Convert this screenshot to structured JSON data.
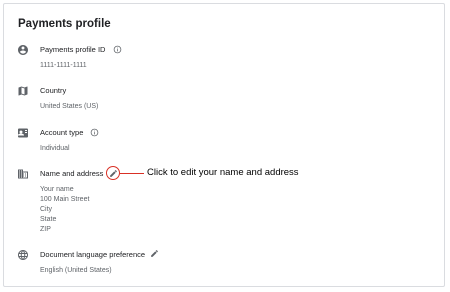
{
  "card": {
    "title": "Payments profile"
  },
  "profile_id": {
    "label": "Payments profile ID",
    "value": "1111-1111-1111",
    "icon": "account-circle-icon"
  },
  "country": {
    "label": "Country",
    "value": "United States (US)",
    "icon": "map-icon"
  },
  "account_type": {
    "label": "Account type",
    "value": "Individual",
    "icon": "id-card-icon"
  },
  "name_address": {
    "label": "Name and address",
    "lines": [
      "Your name",
      "100 Main Street",
      "City",
      "State",
      "ZIP"
    ],
    "icon": "building-icon"
  },
  "callout": {
    "text": "Click to edit your name and address",
    "color": "#d93025"
  },
  "document_language": {
    "label": "Document language preference",
    "value": "English (United States)",
    "icon": "globe-icon"
  }
}
